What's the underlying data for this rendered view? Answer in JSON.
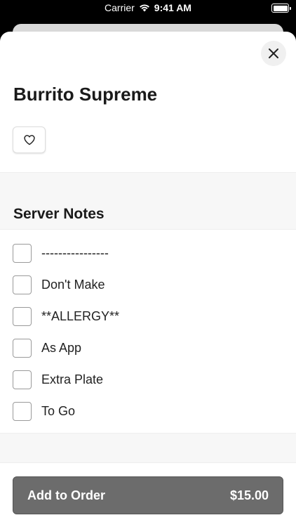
{
  "status_bar": {
    "carrier": "Carrier",
    "time": "9:41 AM"
  },
  "item": {
    "title": "Burrito Supreme"
  },
  "section": {
    "title": "Server Notes"
  },
  "options": [
    {
      "label": "----------------",
      "checked": false
    },
    {
      "label": "Don't Make",
      "checked": false
    },
    {
      "label": "**ALLERGY**",
      "checked": false
    },
    {
      "label": "As App",
      "checked": false
    },
    {
      "label": "Extra Plate",
      "checked": false
    },
    {
      "label": "To Go",
      "checked": false
    }
  ],
  "footer": {
    "add_label": "Add to Order",
    "price": "$15.00"
  },
  "icons": {
    "close": "close-icon",
    "favorite": "heart-icon"
  },
  "colors": {
    "button": "#6c6c6c",
    "band": "#f7f7f7"
  }
}
